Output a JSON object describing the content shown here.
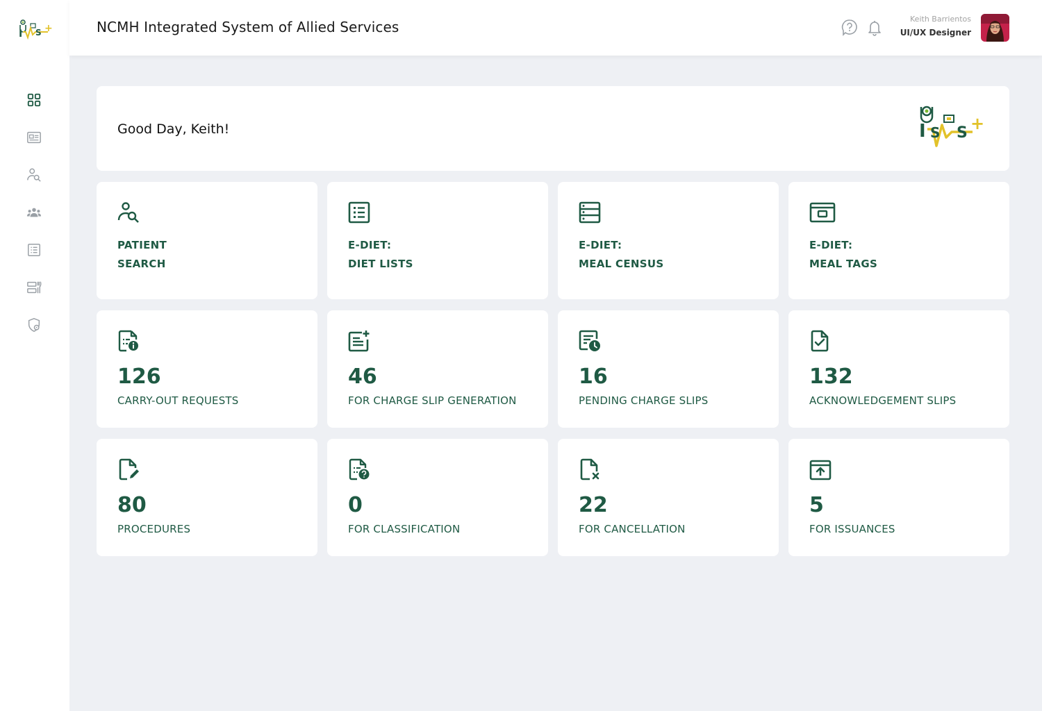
{
  "header": {
    "title": "NCMH Integrated System of Allied Services",
    "user_name": "Keith Barrientos",
    "user_role": "UI/UX Designer",
    "help_icon": "help-circle-icon",
    "bell_icon": "notification-bell-icon"
  },
  "sidebar": {
    "logo": "ISAS+",
    "items": [
      {
        "icon": "dashboard-grid-icon",
        "active": true
      },
      {
        "icon": "id-card-icon",
        "active": false
      },
      {
        "icon": "patient-search-icon",
        "active": false
      },
      {
        "icon": "group-icon",
        "active": false
      },
      {
        "icon": "list-icon",
        "active": false
      },
      {
        "icon": "meal-tags-icon",
        "active": false
      },
      {
        "icon": "shield-settings-icon",
        "active": false
      }
    ]
  },
  "welcome": {
    "greeting": "Good Day, Keith!",
    "logo": "ISAS+"
  },
  "shortcuts": [
    {
      "icon": "patient-search-icon",
      "line1": "PATIENT",
      "line2": "SEARCH"
    },
    {
      "icon": "diet-list-icon",
      "line1": "E-DIET:",
      "line2": "DIET LISTS"
    },
    {
      "icon": "meal-census-icon",
      "line1": "E-DIET:",
      "line2": "MEAL CENSUS"
    },
    {
      "icon": "meal-tag-icon",
      "line1": "E-DIET:",
      "line2": "MEAL TAGS"
    }
  ],
  "stats": [
    {
      "icon": "document-info-icon",
      "count": "126",
      "label": "CARRY-OUT REQUESTS"
    },
    {
      "icon": "document-add-icon",
      "count": "46",
      "label": "FOR CHARGE SLIP GENERATION"
    },
    {
      "icon": "document-clock-icon",
      "count": "16",
      "label": "PENDING CHARGE SLIPS"
    },
    {
      "icon": "document-check-icon",
      "count": "132",
      "label": "ACKNOWLEDGEMENT SLIPS"
    },
    {
      "icon": "document-edit-icon",
      "count": "80",
      "label": "PROCEDURES"
    },
    {
      "icon": "document-question-icon",
      "count": "0",
      "label": "FOR CLASSIFICATION"
    },
    {
      "icon": "document-cancel-icon",
      "count": "22",
      "label": "FOR CANCELLATION"
    },
    {
      "icon": "upload-box-icon",
      "count": "5",
      "label": "FOR ISSUANCES"
    }
  ],
  "colors": {
    "accent": "#1f5a44",
    "logo_yellow": "#e2c22a",
    "background": "#eef0f4",
    "sidebar_icon_inactive": "#9aa0a6"
  }
}
